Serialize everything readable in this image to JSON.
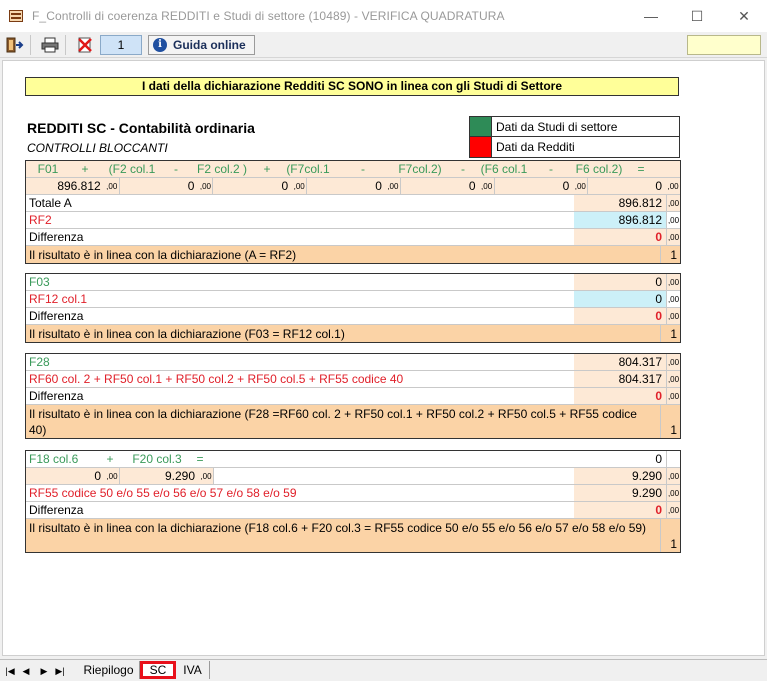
{
  "window": {
    "title": "F_Controlli di coerenza REDDITI e Studi di settore (10489) - VERIFICA QUADRATURA",
    "minimize": "—",
    "maximize": "☐",
    "close": "✕"
  },
  "toolbar": {
    "page_number": "1",
    "guide_label": "Guida online",
    "icons": [
      "exit-icon",
      "print-icon",
      "delete-icon"
    ]
  },
  "banner": "I dati della dichiarazione Redditi SC  SONO  in linea con gli Studi di Settore",
  "heading": "REDDITI SC - Contabilità ordinaria",
  "subheading": "CONTROLLI BLOCCANTI",
  "legend": [
    {
      "label": "Dati da Studi di settore",
      "color": "#2e8b57"
    },
    {
      "label": "Dati da Redditi",
      "color": "#ff0000"
    }
  ],
  "colors": {
    "green_text": "#3a9a5a",
    "red_text": "#e0202a",
    "orange": "#fbd3a6",
    "peach": "#fde9d6",
    "cyan": "#ccf0f8"
  },
  "block1": {
    "formula": [
      "F01",
      "+",
      "(F2 col.1",
      "-",
      "F2 col.2 )",
      "+",
      "(F7col.1",
      "-",
      "F7col.2)",
      "-",
      "(F6 col.1",
      "-",
      "F6 col.2)",
      "="
    ],
    "values": [
      "896.812",
      "0",
      "0",
      "0",
      "0",
      "0",
      "0"
    ],
    "dec": ",00",
    "totale_label": "Totale A",
    "totale_value": "896.812",
    "rf2_label": "RF2",
    "rf2_value": "896.812",
    "diff_label": "Differenza",
    "diff_value": "0",
    "result_text": "Il risultato è in linea con la dichiarazione (A = RF2)",
    "result_flag": "1"
  },
  "block2": {
    "f03_label": "F03",
    "f03_value": "0",
    "rf12_label": "RF12 col.1",
    "rf12_value": "0",
    "diff_label": "Differenza",
    "diff_value": "0",
    "result_text": "Il risultato è in linea con la dichiarazione (F03 = RF12 col.1)",
    "result_flag": "1"
  },
  "block3": {
    "f28_label": "F28",
    "f28_value": "804.317",
    "rf_label": "RF60 col. 2 + RF50 col.1 + RF50 col.2 + RF50 col.5 + RF55 codice 40",
    "rf_value": "804.317",
    "diff_label": "Differenza",
    "diff_value": "0",
    "result_text": "Il risultato è in linea con la dichiarazione (F28 =RF60 col. 2 + RF50 col.1 + RF50 col.2 + RF50 col.5 + RF55 codice 40)",
    "result_flag": "1"
  },
  "block4": {
    "formula": [
      "F18 col.6",
      "+",
      "F20 col.3",
      "="
    ],
    "formula_total": "0",
    "v1": "0",
    "v2": "9.290",
    "sum_value": "9.290",
    "rf55_label": "RF55 codice 50 e/o 55 e/o 56 e/o 57 e/o 58 e/o 59",
    "rf55_value": "9.290",
    "diff_label": "Differenza",
    "diff_value": "0",
    "result_text": "Il risultato è in linea con la dichiarazione (F18 col.6 + F20 col.3 = RF55 codice 50 e/o 55 e/o 56 e/o 57 e/o 58 e/o 59)",
    "result_flag": "1"
  },
  "tabs": {
    "nav": [
      "|◀",
      "◀",
      "▶",
      "▶|"
    ],
    "items": [
      "Riepilogo",
      "SC",
      "IVA"
    ],
    "active": "SC"
  }
}
